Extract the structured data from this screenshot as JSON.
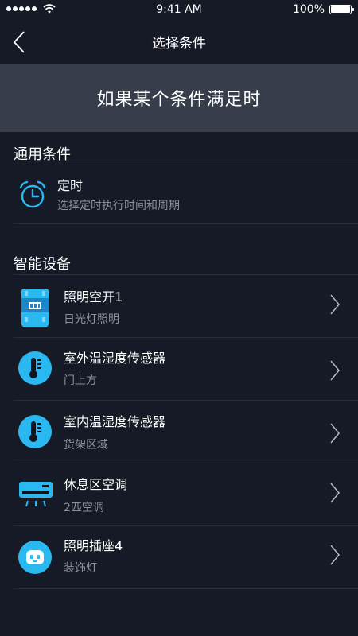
{
  "status": {
    "time": "9:41 AM",
    "battery": "100%"
  },
  "nav": {
    "title": "选择条件"
  },
  "banner": {
    "text": "如果某个条件满足时"
  },
  "general": {
    "title": "通用条件",
    "timer": {
      "title": "定时",
      "subtitle": "选择定时执行时间和周期",
      "icon": "alarm-clock-icon"
    }
  },
  "smart": {
    "title": "智能设备",
    "devices": [
      {
        "title": "照明空开1",
        "subtitle": "日光灯照明",
        "icon": "circuit-breaker-icon"
      },
      {
        "title": "室外温湿度传感器",
        "subtitle": "门上方",
        "icon": "thermometer-icon"
      },
      {
        "title": "室内温湿度传感器",
        "subtitle": "货架区域",
        "icon": "thermometer-icon"
      },
      {
        "title": "休息区空调",
        "subtitle": "2匹空调",
        "icon": "air-conditioner-icon"
      },
      {
        "title": "照明插座4",
        "subtitle": "装饰灯",
        "icon": "power-socket-icon"
      }
    ]
  },
  "colors": {
    "background": "#151a26",
    "banner": "#383d4b",
    "accent": "#2ab8f0",
    "subtext": "#8c919c"
  }
}
